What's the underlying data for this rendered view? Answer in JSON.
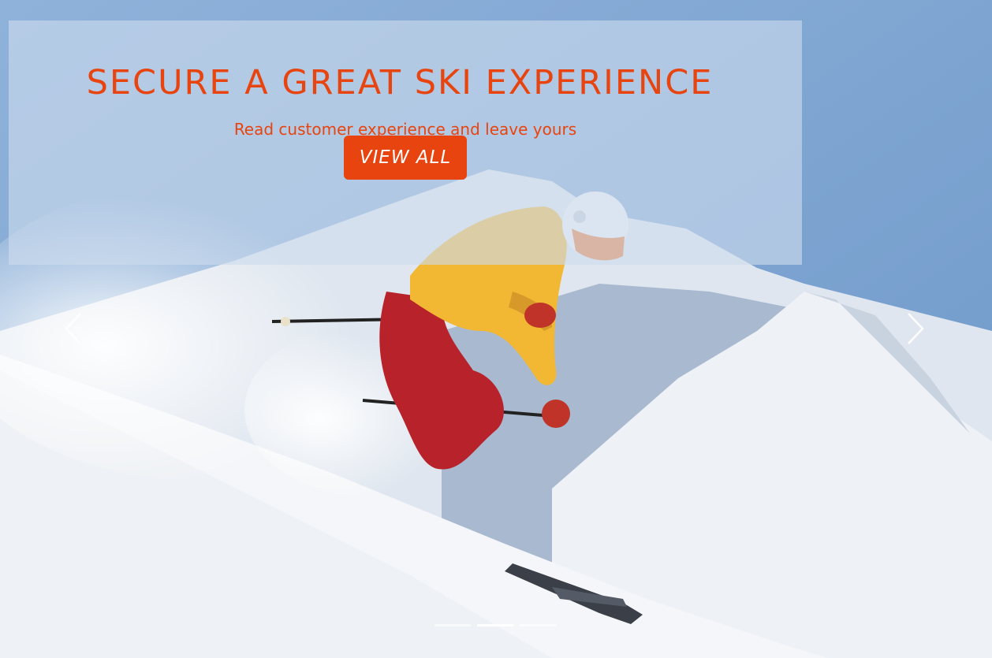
{
  "hero": {
    "title": "SECURE A GREAT SKI EXPERIENCE",
    "subtitle": "Read customer experience and leave yours",
    "cta_label": "VIEW ALL"
  },
  "carousel": {
    "slide_count": 3,
    "active_index": 1,
    "prev_icon": "chevron-left-icon",
    "next_icon": "chevron-right-icon"
  },
  "colors": {
    "accent": "#e8440f",
    "caption_panel": "#cddcee",
    "sky": "#7fa6d2",
    "snow": "#f4f6f9"
  }
}
